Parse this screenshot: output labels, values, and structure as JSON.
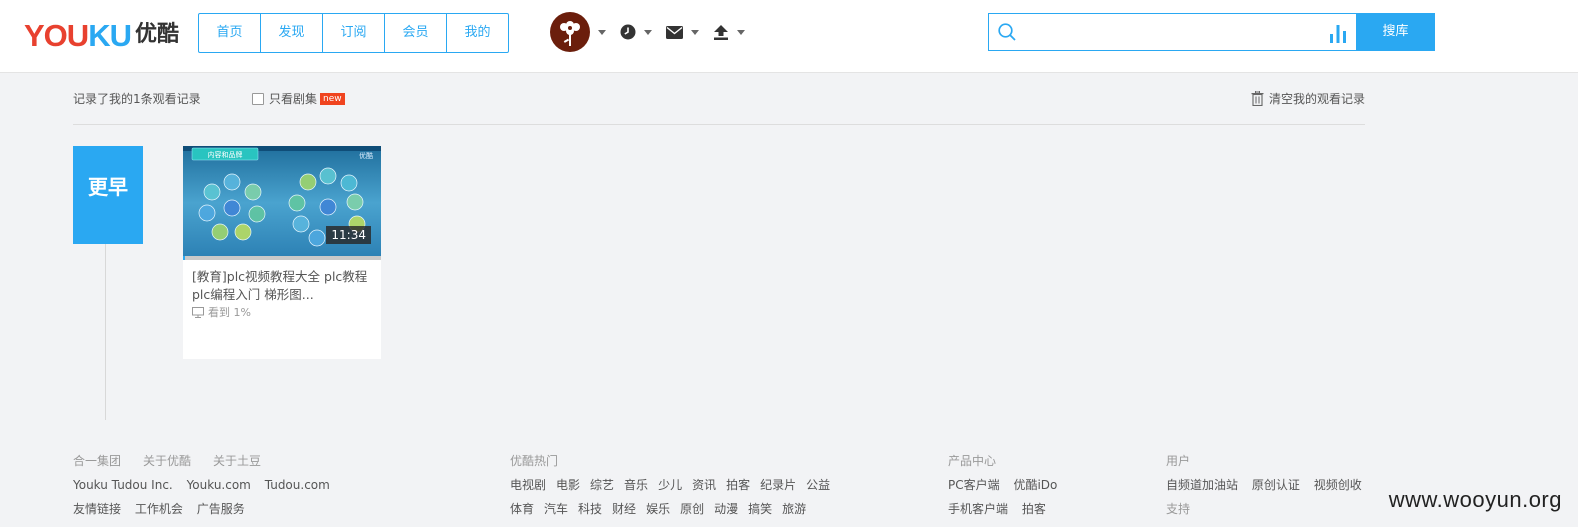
{
  "header": {
    "logo_en": "YOUKU",
    "logo_cn": "优酷",
    "nav": [
      "首页",
      "发现",
      "订阅",
      "会员",
      "我的"
    ],
    "search": {
      "placeholder": "",
      "button": "搜库"
    }
  },
  "toolbar": {
    "summary": "记录了我的1条观看记录",
    "only_series": "只看剧集",
    "new_badge": "new",
    "clear": "清空我的观看记录"
  },
  "timeline": {
    "label": "更早"
  },
  "video": {
    "thumb_text_left": "内容和品牌",
    "thumb_text_right": "优酷",
    "duration": "11:34",
    "title_line1": "[教育]plc视频教程大全 plc教程",
    "title_line2": "plc编程入门 梯形图...",
    "progress_text": "看到 1%",
    "progress": 0.01
  },
  "footer": {
    "col1": {
      "head": [
        "合一集团",
        "关于优酷",
        "关于土豆"
      ],
      "row1": [
        "Youku Tudou Inc.",
        "Youku.com",
        "Tudou.com"
      ],
      "row2": [
        "友情链接",
        "工作机会",
        "广告服务"
      ]
    },
    "col2": {
      "head": "优酷热门",
      "row1": [
        "电视剧",
        "电影",
        "综艺",
        "音乐",
        "少儿",
        "资讯",
        "拍客",
        "纪录片",
        "公益"
      ],
      "row2": [
        "体育",
        "汽车",
        "科技",
        "财经",
        "娱乐",
        "原创",
        "动漫",
        "搞笑",
        "旅游"
      ]
    },
    "col3": {
      "head": "产品中心",
      "row1": [
        "PC客户端",
        "优酷iDo"
      ],
      "row2": [
        "手机客户端",
        "拍客"
      ]
    },
    "col4": {
      "head": "用户",
      "row1": [
        "自频道加油站",
        "原创认证",
        "视频创收"
      ],
      "row2": [
        "支持"
      ]
    }
  },
  "watermark": "www.wooyun.org",
  "colors": {
    "accent": "#2aa8f2",
    "logo_red": "#e8412f",
    "logo_blue": "#2aa8f2",
    "badge": "#f0441f"
  },
  "icons": [
    "search-icon",
    "bars-chart-icon",
    "clock-icon",
    "mail-icon",
    "upload-icon",
    "trash-icon",
    "tv-icon",
    "chevron-down-icon"
  ]
}
